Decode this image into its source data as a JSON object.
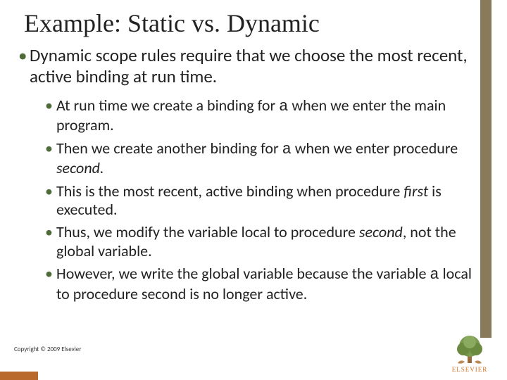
{
  "title": "Example: Static vs. Dynamic",
  "mainBullet": "Dynamic scope rules require that we choose the most recent, active binding at run time.",
  "sub": {
    "b1a": "At run time we create a binding for ",
    "b1var": "a",
    "b1b": " when we enter the main program.",
    "b2a": "Then we create another binding for ",
    "b2var": "a",
    "b2b": " when we enter procedure ",
    "b2c": "second.",
    "b3a": "This is the most recent, active binding when procedure ",
    "b3b": "first",
    "b3c": " is executed.",
    "b4a": "Thus, we modify the variable local to procedure ",
    "b4b": "second",
    "b4c": ", not the global variable.",
    "b5a": "However, we write the global variable because the variable ",
    "b5var": "a",
    "b5b": " local to procedure second is no longer active."
  },
  "copyright": "Copyright © 2009 Elsevier",
  "logoText": "ELSEVIER"
}
